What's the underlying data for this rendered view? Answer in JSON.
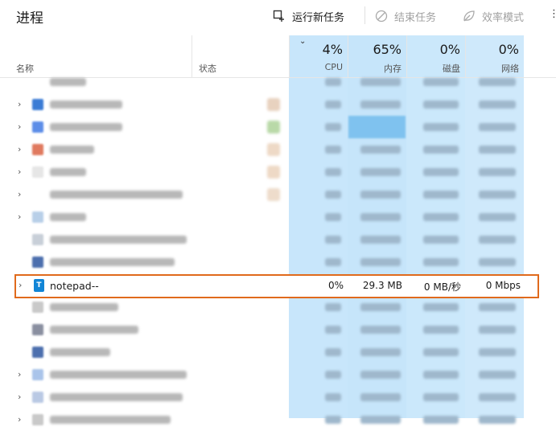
{
  "toolbar": {
    "title": "进程",
    "run_new_task": "运行新任务",
    "end_task": "结束任务",
    "efficiency_mode": "效率模式",
    "more": "⋮"
  },
  "columns": {
    "name": "名称",
    "status": "状态",
    "cpu_pct": "4%",
    "cpu": "CPU",
    "mem_pct": "65%",
    "mem": "内存",
    "disk_pct": "0%",
    "disk": "磁盘",
    "net_pct": "0%",
    "net": "网络"
  },
  "highlighted_process": {
    "name": "notepad--",
    "icon_letter": "T",
    "cpu": "0%",
    "memory": "29.3 MB",
    "disk": "0 MB/秒",
    "network": "0 Mbps"
  },
  "colors": {
    "highlight_border": "#e06a1c",
    "cpu_band": "#c8e6fb",
    "accent": "#1185d6"
  }
}
